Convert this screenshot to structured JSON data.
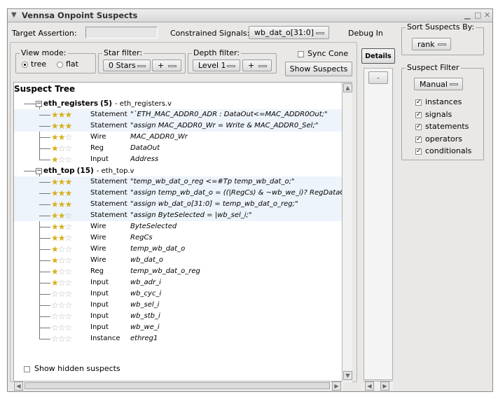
{
  "window": {
    "title": "Vennsa Onpoint Suspects"
  },
  "target_assertion": {
    "label": "Target Assertion:",
    "value": ""
  },
  "constrained_signals": {
    "label": "Constrained Signals:",
    "value": "wb_dat_o[31:0]"
  },
  "debug_in_label": "Debug In",
  "view_mode": {
    "title": "View mode:",
    "options": [
      "tree",
      "flat"
    ],
    "selected": "tree"
  },
  "star_filter": {
    "title": "Star filter:",
    "value": "0 Stars",
    "plus": "+"
  },
  "depth_filter": {
    "title": "Depth filter:",
    "value": "Level 1",
    "plus": "+"
  },
  "sync_cone": {
    "label": "Sync Cone",
    "checked": false
  },
  "show_suspects_label": "Show Suspects",
  "details_tab": "Details",
  "tree": {
    "title": "Suspect Tree",
    "groups": [
      {
        "name": "eth_registers",
        "count": "(5)",
        "file": "- eth_registers.v",
        "items": [
          {
            "stars": 3,
            "type": "Statement",
            "desc": "\"`ETH_MAC_ADDR0_ADR   : DataOut<=MAC_ADDR0Out;\""
          },
          {
            "stars": 3,
            "type": "Statement",
            "desc": "\"assign MAC_ADDR0_Wr   = Write & MAC_ADDR0_Sel;\""
          },
          {
            "stars": 2,
            "type": "Wire",
            "desc": "MAC_ADDR0_Wr"
          },
          {
            "stars": 1,
            "type": "Reg",
            "desc": "DataOut"
          },
          {
            "stars": 1,
            "type": "Input",
            "desc": "Address"
          }
        ]
      },
      {
        "name": "eth_top",
        "count": "(15)",
        "file": "- eth_top.v",
        "items": [
          {
            "stars": 3,
            "type": "Statement",
            "desc": "\"temp_wb_dat_o_reg <=#Tp temp_wb_dat_o;\""
          },
          {
            "stars": 3,
            "type": "Statement",
            "desc": "\"assign temp_wb_dat_o = ((|RegCs) & ~wb_we_i)? RegDataOut : BD"
          },
          {
            "stars": 3,
            "type": "Statement",
            "desc": "\"assign wb_dat_o[31:0] = temp_wb_dat_o_reg;\""
          },
          {
            "stars": 2,
            "type": "Statement",
            "desc": "\"assign ByteSelected = |wb_sel_i;\""
          },
          {
            "stars": 2,
            "type": "Wire",
            "desc": "ByteSelected"
          },
          {
            "stars": 2,
            "type": "Wire",
            "desc": "RegCs"
          },
          {
            "stars": 1,
            "type": "Wire",
            "desc": "temp_wb_dat_o"
          },
          {
            "stars": 1,
            "type": "Wire",
            "desc": "wb_dat_o"
          },
          {
            "stars": 1,
            "type": "Reg",
            "desc": "temp_wb_dat_o_reg"
          },
          {
            "stars": 1,
            "type": "Input",
            "desc": "wb_adr_i"
          },
          {
            "stars": 0,
            "type": "Input",
            "desc": "wb_cyc_i"
          },
          {
            "stars": 0,
            "type": "Input",
            "desc": "wb_sel_i"
          },
          {
            "stars": 0,
            "type": "Input",
            "desc": "wb_stb_i"
          },
          {
            "stars": 0,
            "type": "Input",
            "desc": "wb_we_i"
          },
          {
            "stars": 0,
            "type": "Instance",
            "desc": "ethreg1"
          }
        ]
      }
    ]
  },
  "show_hidden": {
    "label": "Show hidden suspects",
    "checked": false
  },
  "sort_by": {
    "title": "Sort Suspects By:",
    "value": "rank"
  },
  "suspect_filter": {
    "title": "Suspect Filter",
    "mode": "Manual",
    "options": [
      {
        "label": "instances",
        "checked": true
      },
      {
        "label": "signals",
        "checked": true
      },
      {
        "label": "statements",
        "checked": true
      },
      {
        "label": "operators",
        "checked": true
      },
      {
        "label": "conditionals",
        "checked": true
      }
    ]
  },
  "colors": {
    "star": "#d6b01b",
    "row_highlight": "#eef4fb",
    "window_bg": "#e9e8e6"
  },
  "icons": [
    "window-menu-icon",
    "minimize-icon",
    "maximize-icon",
    "close-icon",
    "star-icon",
    "scroll-up-icon",
    "scroll-down-icon",
    "scroll-left-icon",
    "scroll-right-icon"
  ]
}
